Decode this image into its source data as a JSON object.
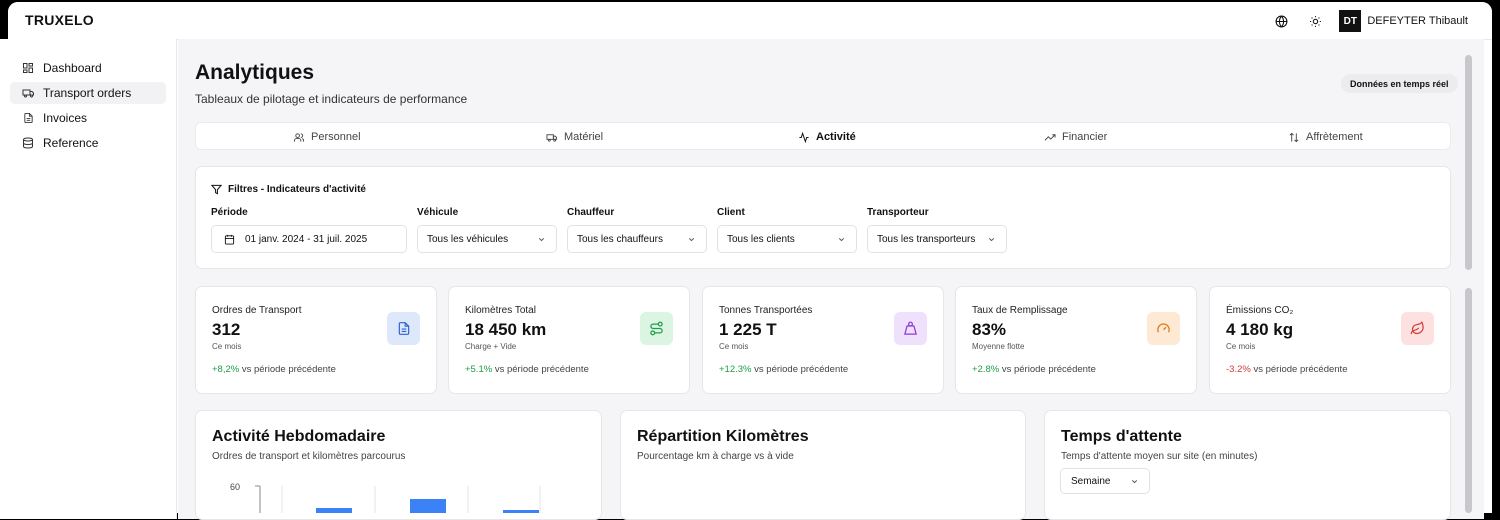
{
  "app": {
    "brand": "TRUXELO",
    "user_initials": "DT",
    "user_name": "DEFEYTER Thibault"
  },
  "sidebar": {
    "items": [
      {
        "label": "Dashboard",
        "icon": "grid-icon",
        "active": false
      },
      {
        "label": "Transport orders",
        "icon": "truck-icon",
        "active": true
      },
      {
        "label": "Invoices",
        "icon": "document-icon",
        "active": false
      },
      {
        "label": "Reference",
        "icon": "database-icon",
        "active": false
      }
    ]
  },
  "header": {
    "title": "Analytiques",
    "subtitle": "Tableaux de pilotage et indicateurs de performance",
    "badge": "Données en temps réel"
  },
  "tabs": [
    {
      "label": "Personnel",
      "icon": "users-icon"
    },
    {
      "label": "Matériel",
      "icon": "truck-icon"
    },
    {
      "label": "Activité",
      "icon": "activity-icon",
      "active": true
    },
    {
      "label": "Financier",
      "icon": "trending-up-icon"
    },
    {
      "label": "Affrètement",
      "icon": "arrows-up-down-icon"
    }
  ],
  "filters": {
    "title": "Filtres - Indicateurs d'activité",
    "periode": {
      "label": "Période",
      "value": "01 janv. 2024 - 31 juil. 2025"
    },
    "vehicule": {
      "label": "Véhicule",
      "value": "Tous les véhicules"
    },
    "chauffeur": {
      "label": "Chauffeur",
      "value": "Tous les chauffeurs"
    },
    "client": {
      "label": "Client",
      "value": "Tous les clients"
    },
    "transporteur": {
      "label": "Transporteur",
      "value": "Tous les transporteurs"
    }
  },
  "kpis": [
    {
      "label": "Ordres de Transport",
      "value": "312",
      "sub": "Ce mois",
      "delta": "+8,2%",
      "delta_text": "vs période précédente",
      "trend": "positive",
      "icon": "document-icon",
      "color": "#dde8fb"
    },
    {
      "label": "Kilomètres Total",
      "value": "18 450 km",
      "sub": "Charge + Vide",
      "delta": "+5.1%",
      "delta_text": "vs période précédente",
      "trend": "positive",
      "icon": "route-icon",
      "color": "#dcf5e3"
    },
    {
      "label": "Tonnes Transportées",
      "value": "1 225 T",
      "sub": "Ce mois",
      "delta": "+12.3%",
      "delta_text": "vs période précédente",
      "trend": "positive",
      "icon": "weight-icon",
      "color": "#efe1fb"
    },
    {
      "label": "Taux de Remplissage",
      "value": "83%",
      "sub": "Moyenne flotte",
      "delta": "+2.8%",
      "delta_text": "vs période précédente",
      "trend": "positive",
      "icon": "gauge-icon",
      "color": "#fde9d4"
    },
    {
      "label": "Émissions CO₂",
      "value": "4 180 kg",
      "sub": "Ce mois",
      "delta": "-3.2%",
      "delta_text": "vs période précédente",
      "trend": "negative",
      "icon": "leaf-icon",
      "color": "#fde1e1"
    }
  ],
  "charts": {
    "weekly": {
      "title": "Activité Hebdomadaire",
      "subtitle": "Ordres de transport et kilomètres parcourus",
      "tick": "60"
    },
    "km": {
      "title": "Répartition Kilomètres",
      "subtitle": "Pourcentage km à charge vs à vide"
    },
    "wait": {
      "title": "Temps d'attente",
      "subtitle": "Temps d'attente moyen sur site (en minutes)",
      "select": "Semaine"
    }
  },
  "chart_data": {
    "type": "bar",
    "title": "Activité Hebdomadaire",
    "ylim": [
      0,
      60
    ],
    "yticks": [
      "60"
    ],
    "categories": [],
    "series": [
      {
        "values": []
      }
    ]
  }
}
